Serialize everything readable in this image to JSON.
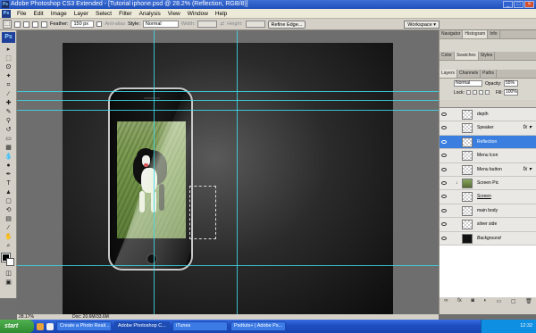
{
  "window": {
    "title": "Adobe Photoshop CS3 Extended - [Tutorial iphone.psd @ 28.2% (Reflection, RGB/8)]"
  },
  "menu": [
    "File",
    "Edit",
    "Image",
    "Layer",
    "Select",
    "Filter",
    "Analysis",
    "View",
    "Window",
    "Help"
  ],
  "options": {
    "feather_label": "Feather:",
    "feather_value": "150 px",
    "antialias_label": "Anti-alias",
    "style_label": "Style:",
    "style_value": "Normal",
    "width_label": "Width:",
    "height_label": "Height:",
    "refine_label": "Refine Edge...",
    "workspace_label": "Workspace ▾"
  },
  "panels": {
    "top_tabs": [
      "Navigator",
      "Histogram",
      "Info"
    ],
    "mid_tabs": [
      "Color",
      "Swatches",
      "Styles"
    ],
    "layer_tabs": [
      "Layers",
      "Channels",
      "Paths"
    ],
    "blend_mode": "Normal",
    "opacity_label": "Opacity:",
    "opacity_value": "55%",
    "lock_label": "Lock:",
    "fill_label": "Fill:",
    "fill_value": "100%"
  },
  "layers": [
    {
      "name": "depth",
      "selected": false,
      "fx": false,
      "thumb": "transparent"
    },
    {
      "name": "Speaker",
      "selected": false,
      "fx": true,
      "thumb": "transparent"
    },
    {
      "name": "Reflection",
      "selected": true,
      "fx": false,
      "thumb": "transparent"
    },
    {
      "name": "Menu Icon",
      "selected": false,
      "fx": false,
      "thumb": "transparent"
    },
    {
      "name": "Menu button",
      "selected": false,
      "fx": true,
      "thumb": "transparent"
    },
    {
      "name": "Screen Pic",
      "selected": false,
      "fx": false,
      "thumb": "photo"
    },
    {
      "name": "Screen",
      "selected": false,
      "fx": false,
      "thumb": "transparent"
    },
    {
      "name": "main body",
      "selected": false,
      "fx": false,
      "thumb": "transparent"
    },
    {
      "name": "silver side",
      "selected": false,
      "fx": false,
      "thumb": "transparent"
    },
    {
      "name": "Background",
      "selected": false,
      "fx": false,
      "thumb": "black"
    }
  ],
  "status": {
    "zoom": "28.17%",
    "doc": "Doc: 20.6M/33.6M"
  },
  "taskbar": {
    "start": "start",
    "tasks": [
      "Create a Photo Reali...",
      "Adobe Photoshop C...",
      "iTunes",
      "Psdtuts+ | Adobe Ps..."
    ],
    "clock": "12:32"
  }
}
